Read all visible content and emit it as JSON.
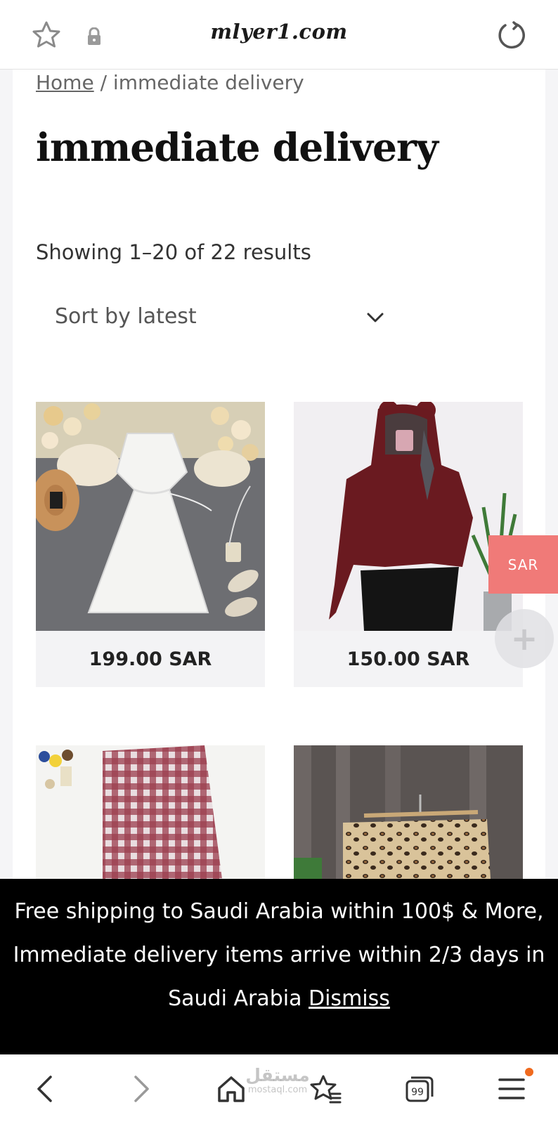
{
  "browser": {
    "domain": "mlyer1.com"
  },
  "breadcrumb": {
    "home": "Home",
    "separator": " / ",
    "current": "immediate delivery"
  },
  "page": {
    "title": "immediate delivery",
    "results": "Showing 1–20 of 22 results",
    "sort_selected": "Sort by latest"
  },
  "products": [
    {
      "price": "199.00 SAR",
      "image": "white-dress-photo"
    },
    {
      "price": "150.00 SAR",
      "image": "maroon-hoodie-photo"
    },
    {
      "price": "",
      "image": "plaid-skirt-photo"
    },
    {
      "price": "",
      "image": "leopard-outfit-photo"
    }
  ],
  "currency": {
    "label": "SAR",
    "plus": "+"
  },
  "notice": {
    "text": "Free shipping to Saudi Arabia within 100$ & More, Immediate delivery items arrive within 2/3 days in Saudi Arabia ",
    "dismiss": "Dismiss"
  },
  "watermark": {
    "arabic": "مستقل",
    "latin": "mostaql.com"
  },
  "colors": {
    "accent_sar": "#f07a78",
    "notice_bg": "#000000",
    "notification_dot": "#f06a1e"
  },
  "icons": [
    "star-icon",
    "lock-icon",
    "reload-icon",
    "chevron-down-icon",
    "back-icon",
    "forward-icon",
    "home-icon",
    "bookmarks-icon",
    "tabs-icon",
    "menu-icon"
  ]
}
